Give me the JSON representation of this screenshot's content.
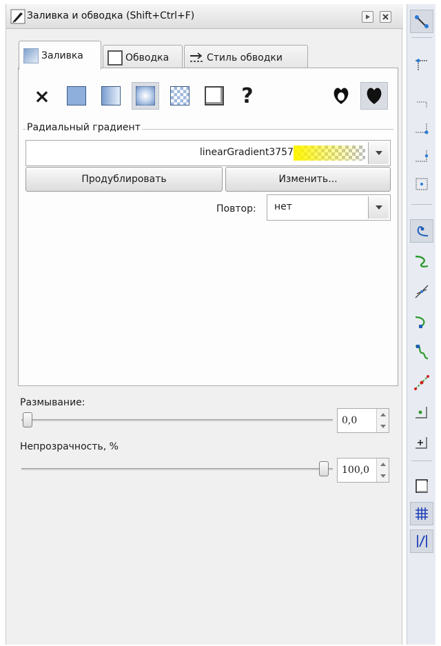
{
  "window": {
    "title": "Заливка и обводка (Shift+Ctrl+F)"
  },
  "tabs": [
    {
      "label": "Заливка",
      "icon": "fill-tab-icon",
      "active": true
    },
    {
      "label": "Обводка",
      "icon": "stroke-paint-tab-icon",
      "active": false
    },
    {
      "label": "Стиль обводки",
      "icon": "stroke-style-tab-icon",
      "active": false
    }
  ],
  "paint_modes": [
    {
      "name": "no-paint",
      "symbol": "×"
    },
    {
      "name": "flat-color"
    },
    {
      "name": "linear-gradient"
    },
    {
      "name": "radial-gradient",
      "selected": true
    },
    {
      "name": "pattern"
    },
    {
      "name": "swatch"
    },
    {
      "name": "unset",
      "symbol": "?"
    },
    {
      "name": "fill-rule-evenodd"
    },
    {
      "name": "fill-rule-nonzero",
      "selected": true
    }
  ],
  "gradient": {
    "section_label": "Радиальный градиент",
    "selected": "linearGradient3757",
    "preview_color": "#fff500",
    "duplicate_button": "Продублировать",
    "edit_button": "Изменить...",
    "repeat_label": "Повтор:",
    "repeat_value": "нет"
  },
  "blur": {
    "label": "Размывание:",
    "value_text": "0,0",
    "fraction": 0.0
  },
  "opacity": {
    "label": "Непрозрачность, %",
    "value_text": "100,0",
    "fraction": 1.0
  },
  "snap_toolbar": [
    "snap-enable-icon",
    "snap-bbox-icon",
    "snap-bbox-edge-icon",
    "snap-bbox-corner-icon",
    "snap-bbox-edge-midpoint-icon",
    "snap-bbox-center-icon",
    "snap-nodes-icon",
    "snap-path-icon",
    "snap-path-intersection-icon",
    "snap-cusp-nodes-icon",
    "snap-smooth-nodes-icon",
    "snap-line-midpoint-icon",
    "snap-object-center-icon",
    "snap-rotation-center-icon",
    "snap-page-border-icon",
    "snap-grid-icon",
    "snap-guide-icon"
  ]
}
